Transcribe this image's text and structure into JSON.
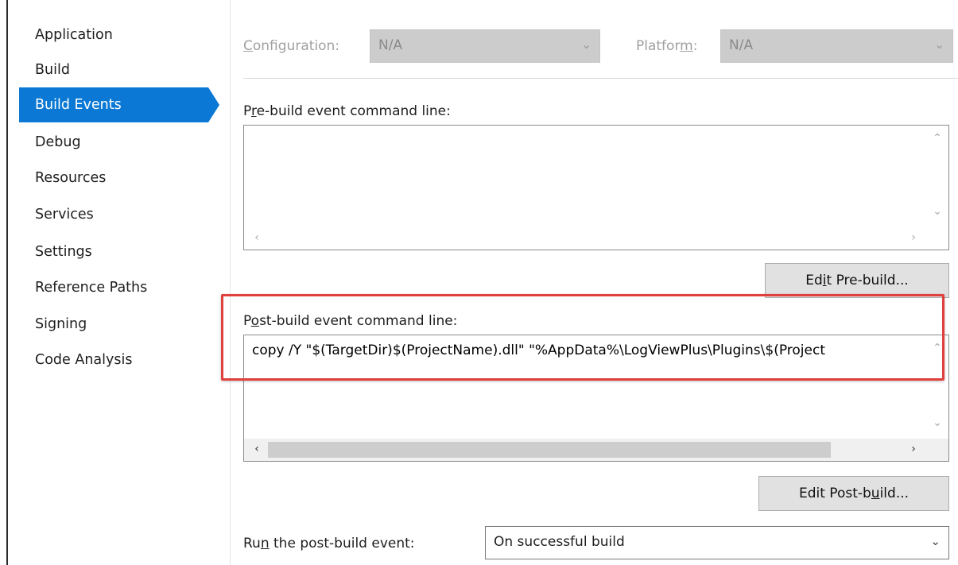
{
  "sidebar": {
    "items": [
      {
        "label": "Application"
      },
      {
        "label": "Build"
      },
      {
        "label": "Build Events"
      },
      {
        "label": "Debug"
      },
      {
        "label": "Resources"
      },
      {
        "label": "Services"
      },
      {
        "label": "Settings"
      },
      {
        "label": "Reference Paths"
      },
      {
        "label": "Signing"
      },
      {
        "label": "Code Analysis"
      }
    ],
    "active_index": 2
  },
  "config": {
    "configuration_label_pre": "",
    "configuration_label_u": "C",
    "configuration_label_post": "onfiguration:",
    "configuration_value": "N/A",
    "platform_label_pre": "Platfor",
    "platform_label_u": "m",
    "platform_label_post": ":",
    "platform_value": "N/A"
  },
  "prebuild": {
    "label_pre": "P",
    "label_u": "r",
    "label_post": "e-build event command line:",
    "command": "",
    "edit_button_pre": "Ed",
    "edit_button_u": "i",
    "edit_button_post": "t Pre-build..."
  },
  "postbuild": {
    "label_pre": "P",
    "label_u": "o",
    "label_post": "st-build event command line:",
    "command": "copy /Y \"$(TargetDir)$(ProjectName).dll\" \"%AppData%\\LogViewPlus\\Plugins\\$(Project",
    "edit_button_pre": "Edit Post-b",
    "edit_button_u": "u",
    "edit_button_post": "ild..."
  },
  "run_event": {
    "label_pre": "Ru",
    "label_u": "n",
    "label_post": " the post-build event:",
    "selected": "On successful build"
  },
  "icons": {
    "up": "chevron-up-icon",
    "down": "chevron-down-icon",
    "left": "chevron-left-icon",
    "right": "chevron-right-icon"
  },
  "colors": {
    "accent": "#0a78d4",
    "highlight_box": "#e0403e"
  }
}
